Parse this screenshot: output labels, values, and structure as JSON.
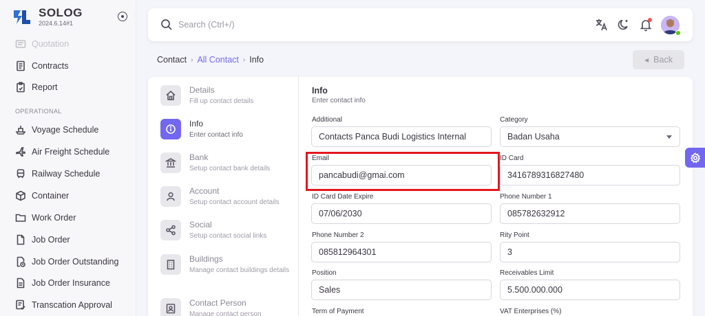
{
  "brand": {
    "name": "SOLOG",
    "version": "2024.6.14#1"
  },
  "sidebar": {
    "items": [
      {
        "label": "Quotation",
        "icon": "quotation-icon"
      },
      {
        "label": "Contracts",
        "icon": "contracts-icon"
      },
      {
        "label": "Report",
        "icon": "report-icon"
      },
      {
        "label": "Voyage Schedule",
        "icon": "ship-icon"
      },
      {
        "label": "Air Freight Schedule",
        "icon": "plane-icon"
      },
      {
        "label": "Railway Schedule",
        "icon": "train-icon"
      },
      {
        "label": "Container",
        "icon": "container-icon"
      },
      {
        "label": "Work Order",
        "icon": "folder-icon"
      },
      {
        "label": "Job Order",
        "icon": "file-icon"
      },
      {
        "label": "Job Order Outstanding",
        "icon": "file-clock-icon"
      },
      {
        "label": "Job Order Insurance",
        "icon": "file-text-icon"
      },
      {
        "label": "Transcation Approval",
        "icon": "approval-icon"
      }
    ],
    "section_operational": "OPERATIONAL"
  },
  "search": {
    "placeholder": "Search (Ctrl+/)"
  },
  "breadcrumb": {
    "root": "Contact",
    "link": "All Contact",
    "current": "Info"
  },
  "back_label": "Back",
  "steps": [
    {
      "title": "Details",
      "sub": "Fill up contact details",
      "icon": "home-icon"
    },
    {
      "title": "Info",
      "sub": "Enter contact info",
      "icon": "info-icon"
    },
    {
      "title": "Bank",
      "sub": "Setup contact bank details",
      "icon": "bank-icon"
    },
    {
      "title": "Account",
      "sub": "Setup contact account details",
      "icon": "user-icon"
    },
    {
      "title": "Social",
      "sub": "Setup contact social links",
      "icon": "share-icon"
    },
    {
      "title": "Buildings",
      "sub": "Manage contact buildings details",
      "icon": "building-icon"
    },
    {
      "title": "Contact Person",
      "sub": "Manage contact person",
      "icon": "contact-person-icon"
    }
  ],
  "form": {
    "title": "Info",
    "subtitle": "Enter contact info",
    "fields": {
      "additional": {
        "label": "Additional",
        "value": "Contacts Panca Budi Logistics Internal"
      },
      "category": {
        "label": "Category",
        "value": "Badan Usaha"
      },
      "email": {
        "label": "Email",
        "value": "pancabudi@gmai.com"
      },
      "id_card": {
        "label": "ID Card",
        "value": "3416789316827480"
      },
      "id_expire": {
        "label": "ID Card Date Expire",
        "value": "07/06/2030"
      },
      "phone1": {
        "label": "Phone Number 1",
        "value": "085782632912"
      },
      "phone2": {
        "label": "Phone Number 2",
        "value": "085812964301"
      },
      "rity": {
        "label": "Rity Point",
        "value": "3"
      },
      "position": {
        "label": "Position",
        "value": "Sales"
      },
      "receivables": {
        "label": "Receivables Limit",
        "value": "5.500.000.000"
      },
      "term": {
        "label": "Term of Payment",
        "value": ""
      },
      "vat": {
        "label": "VAT Enterprises (%)",
        "value": ""
      }
    }
  },
  "colors": {
    "accent": "#7367f0",
    "highlight": "#e4161d",
    "online": "#56ca00",
    "notification": "#ff4c51"
  }
}
